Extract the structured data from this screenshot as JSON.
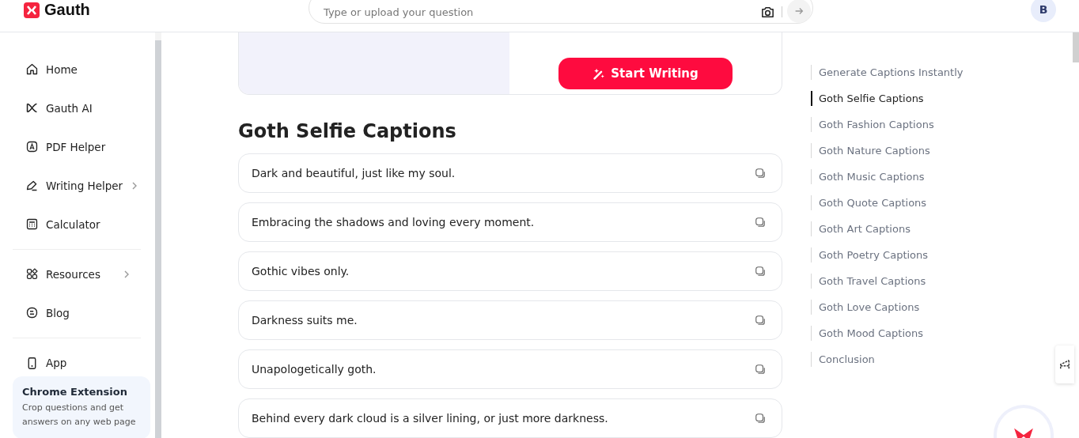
{
  "header": {
    "brand": "Gauth",
    "search": {
      "placeholder": "Type or upload your question"
    },
    "avatar": "B"
  },
  "sidebar": {
    "items": [
      {
        "label": "Home",
        "has_submenu": false
      },
      {
        "label": "Gauth AI",
        "has_submenu": false
      },
      {
        "label": "PDF Helper",
        "has_submenu": false
      },
      {
        "label": "Writing Helper",
        "has_submenu": true
      },
      {
        "label": "Calculator",
        "has_submenu": false
      },
      {
        "label": "Resources",
        "has_submenu": true
      },
      {
        "label": "Blog",
        "has_submenu": false
      },
      {
        "label": "App",
        "has_submenu": false
      }
    ],
    "promo": {
      "title": "Chrome Extension",
      "text": "Crop questions and get answers on any web page"
    }
  },
  "main": {
    "start_button": "Start Writing",
    "heading": "Goth Selfie Captions",
    "captions": [
      "Dark and beautiful, just like my soul.",
      "Embracing the shadows and loving every moment.",
      "Gothic vibes only.",
      "Darkness suits me.",
      "Unapologetically goth.",
      "Behind every dark cloud is a silver lining, or just more darkness."
    ]
  },
  "toc": [
    {
      "label": "Generate Captions Instantly",
      "selected": false
    },
    {
      "label": "Goth Selfie Captions",
      "selected": true
    },
    {
      "label": "Goth Fashion Captions",
      "selected": false
    },
    {
      "label": "Goth Nature Captions",
      "selected": false
    },
    {
      "label": "Goth Music Captions",
      "selected": false
    },
    {
      "label": "Goth Quote Captions",
      "selected": false
    },
    {
      "label": "Goth Art Captions",
      "selected": false
    },
    {
      "label": "Goth Poetry Captions",
      "selected": false
    },
    {
      "label": "Goth Travel Captions",
      "selected": false
    },
    {
      "label": "Goth Love Captions",
      "selected": false
    },
    {
      "label": "Goth Mood Captions",
      "selected": false
    },
    {
      "label": "Conclusion",
      "selected": false
    }
  ]
}
